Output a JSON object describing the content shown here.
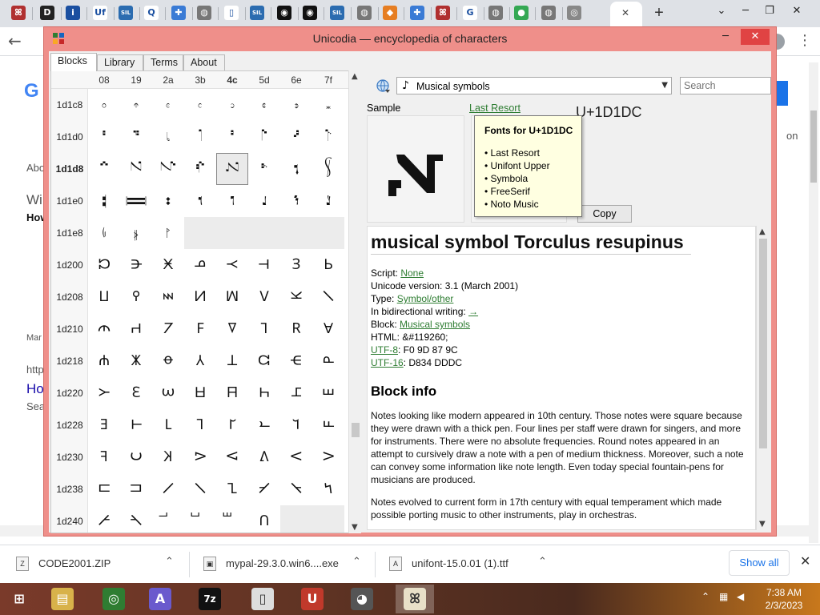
{
  "browser": {
    "tab_icons": [
      {
        "name": "unicode-icon",
        "glyph": "ꕤ",
        "bg": "#b03030"
      },
      {
        "name": "d-icon",
        "glyph": "D",
        "bg": "#222222"
      },
      {
        "name": "info-icon",
        "glyph": "i",
        "bg": "#1a4fa0"
      },
      {
        "name": "uf-icon",
        "glyph": "Uf",
        "bg": "#ffffff"
      },
      {
        "name": "sil-icon",
        "glyph": "SIL",
        "bg": "#2b6cb0"
      },
      {
        "name": "q-icon",
        "glyph": "Q",
        "bg": "#ffffff"
      },
      {
        "name": "puzzle-icon",
        "glyph": "✚",
        "bg": "#3a7bd5"
      },
      {
        "name": "globe-icon",
        "glyph": "◍",
        "bg": "#777777"
      },
      {
        "name": "page-icon",
        "glyph": "▯",
        "bg": "#ffffff"
      },
      {
        "name": "sil-icon",
        "glyph": "SIL",
        "bg": "#2b6cb0"
      },
      {
        "name": "swirl-icon",
        "glyph": "◉",
        "bg": "#111111"
      },
      {
        "name": "swirl-icon",
        "glyph": "◉",
        "bg": "#111111"
      },
      {
        "name": "sil-icon",
        "glyph": "SIL",
        "bg": "#2b6cb0"
      },
      {
        "name": "globe-icon",
        "glyph": "◍",
        "bg": "#777777"
      },
      {
        "name": "diamond-icon",
        "glyph": "◆",
        "bg": "#e67e22"
      },
      {
        "name": "puzzle-icon",
        "glyph": "✚",
        "bg": "#3a7bd5"
      },
      {
        "name": "unicode-icon",
        "glyph": "ꕤ",
        "bg": "#b03030"
      },
      {
        "name": "google-icon",
        "glyph": "G",
        "bg": "#ffffff"
      },
      {
        "name": "globe-icon",
        "glyph": "◍",
        "bg": "#777777"
      },
      {
        "name": "maps-icon",
        "glyph": "●",
        "bg": "#34a853"
      },
      {
        "name": "globe-icon",
        "glyph": "◍",
        "bg": "#777777"
      },
      {
        "name": "chrome-icon",
        "glyph": "◎",
        "bg": "#888888"
      }
    ],
    "active_tab_close": "✕",
    "new_tab": "+",
    "window_controls": {
      "dropdown": "⌄",
      "minimize": "─",
      "restore": "❐",
      "close": "✕"
    }
  },
  "background_page": {
    "logo": "G",
    "snippets": [
      "Abo",
      "Wi",
      "How",
      "Mar",
      "http",
      "Ho",
      "Sea",
      "on"
    ]
  },
  "app": {
    "title": "Unicodia — encyclopedia of characters",
    "window_controls": {
      "minimize": "─",
      "maximize": "☐",
      "close": "✕"
    },
    "tabs": [
      "Blocks",
      "Library",
      "Terms",
      "About"
    ],
    "active_tab": "Blocks",
    "grid": {
      "columns": [
        "08",
        "19",
        "2a",
        "3b",
        "4c",
        "5d",
        "6e",
        "7f"
      ],
      "bold_column": "4c",
      "rows": [
        {
          "label": "1d1c8",
          "cells": [
            "𝇈",
            "𝇉",
            "𝇊",
            "𝇋",
            "𝇌",
            "𝇍",
            "𝇎",
            "𝇏"
          ]
        },
        {
          "label": "1d1d0",
          "cells": [
            "𝇐",
            "𝇑",
            "𝇒",
            "𝇓",
            "𝇔",
            "𝇕",
            "𝇖",
            "𝇗"
          ]
        },
        {
          "label": "1d1d8",
          "cells": [
            "𝇘",
            "𝇙",
            "𝇚",
            "𝇛",
            "𝇜",
            "𝇝",
            "𝇞",
            "𝇟"
          ],
          "bold": true
        },
        {
          "label": "1d1e0",
          "cells": [
            "𝇠",
            "𝇡",
            "𝇢",
            "𝇣",
            "𝇤",
            "𝇥",
            "𝇦",
            "𝇧"
          ]
        },
        {
          "label": "1d1e8",
          "cells": [
            "𝇨",
            "𝇩",
            "𝇪",
            "",
            "",
            "",
            "",
            ""
          ]
        },
        {
          "label": "1d200",
          "cells": [
            "𝈀",
            "𝈁",
            "𝈂",
            "𝈃",
            "𝈄",
            "𝈅",
            "𝈆",
            "𝈇"
          ]
        },
        {
          "label": "1d208",
          "cells": [
            "𝈈",
            "𝈉",
            "𝈊",
            "𝈋",
            "𝈌",
            "𝈍",
            "𝈎",
            "𝈏"
          ]
        },
        {
          "label": "1d210",
          "cells": [
            "𝈐",
            "𝈑",
            "𝈒",
            "𝈓",
            "𝈔",
            "𝈕",
            "𝈖",
            "𝈗"
          ]
        },
        {
          "label": "1d218",
          "cells": [
            "𝈘",
            "𝈙",
            "𝈚",
            "𝈛",
            "𝈜",
            "𝈝",
            "𝈞",
            "𝈟"
          ]
        },
        {
          "label": "1d220",
          "cells": [
            "𝈠",
            "𝈡",
            "𝈢",
            "𝈣",
            "𝈤",
            "𝈥",
            "𝈦",
            "𝈧"
          ]
        },
        {
          "label": "1d228",
          "cells": [
            "𝈨",
            "𝈩",
            "𝈪",
            "𝈫",
            "𝈬",
            "𝈭",
            "𝈮",
            "𝈯"
          ]
        },
        {
          "label": "1d230",
          "cells": [
            "𝈰",
            "𝈱",
            "𝈲",
            "𝈳",
            "𝈴",
            "𝈵",
            "𝈶",
            "𝈷"
          ]
        },
        {
          "label": "1d238",
          "cells": [
            "𝈸",
            "𝈹",
            "𝈺",
            "𝈻",
            "𝈼",
            "𝈽",
            "𝈾",
            "𝈿"
          ]
        },
        {
          "label": "1d240",
          "cells": [
            "𝉀",
            "𝉁",
            "𝉂",
            "𝉃",
            "𝉄",
            "𝉅",
            "",
            ""
          ]
        }
      ]
    },
    "block_picker": {
      "icon": "♪",
      "value": "Musical symbols"
    },
    "search_placeholder": "Search",
    "sample_label": "Sample",
    "font_link": "Last Resort",
    "codepoint": "U+1D1DC",
    "copy_label": "Copy",
    "tooltip": {
      "title": "Fonts for U+1D1DC",
      "fonts": [
        "Last Resort",
        "Unifont Upper",
        "Symbola",
        "FreeSerif",
        "Noto Music"
      ]
    },
    "char_name": "musical symbol Torculus resupinus",
    "props": {
      "script_label": "Script: ",
      "script_value": "None",
      "version_label": "Unicode version: 3.1 (March 2001)",
      "type_label": "Type: ",
      "type_value": "Symbol/other",
      "bidi_label": "In bidirectional writing: ",
      "bidi_value": "→",
      "block_label": "Block: ",
      "block_value": "Musical symbols",
      "html_label": "HTML: &#119260;",
      "utf8_label": "UTF-8",
      "utf8_value": ": F0 9D 87 9C",
      "utf16_label": "UTF-16",
      "utf16_value": ": D834 DDDC"
    },
    "block_info_title": "Block info",
    "block_info_p1": "Notes looking like modern appeared in 10th century. Those notes were square because they were drawn with a thick pen. Four lines per staff were drawn for singers, and more for instruments. There were no absolute frequencies. Round notes appeared in an attempt to cursively draw a note with a pen of medium thickness. Moreover, such a note can convey some information like note length. Even today special fountain-pens for musicians are produced.",
    "block_info_p2": "Notes evolved to current form in 17th century with equal temperament which made possible porting music to other instruments, play in orchestras."
  },
  "downloads": [
    {
      "name": "CODE2001.ZIP",
      "icon": "Z"
    },
    {
      "name": "mypal-29.3.0.win6....exe",
      "icon": "▣"
    },
    {
      "name": "unifont-15.0.01 (1).ttf",
      "icon": "A"
    }
  ],
  "downloads_chevron": "⌃",
  "show_all": "Show all",
  "downloads_close": "✕",
  "taskbar": {
    "apps": [
      {
        "name": "start-button",
        "glyph": "⊞",
        "bg": "transparent"
      },
      {
        "name": "file-explorer-icon",
        "glyph": "▤",
        "bg": "#d8b24a"
      },
      {
        "name": "chrome-icon",
        "glyph": "◎",
        "bg": "#2f7d32"
      },
      {
        "name": "font-app-icon",
        "glyph": "A",
        "bg": "#6a5acd"
      },
      {
        "name": "7zip-icon",
        "glyph": "7z",
        "bg": "#111111"
      },
      {
        "name": "document-icon",
        "glyph": "▯",
        "bg": "#dddddd"
      },
      {
        "name": "unicode-app-icon",
        "glyph": "U",
        "bg": "#c0392b"
      },
      {
        "name": "raccoon-icon",
        "glyph": "◕",
        "bg": "#555555"
      },
      {
        "name": "unicodia-icon",
        "glyph": "ꕤ",
        "bg": "#e8e0c8"
      }
    ],
    "tray": {
      "chevron": "⌃",
      "network": "▦",
      "volume": "◀"
    },
    "time": "7:38 AM",
    "date": "2/3/2023"
  }
}
